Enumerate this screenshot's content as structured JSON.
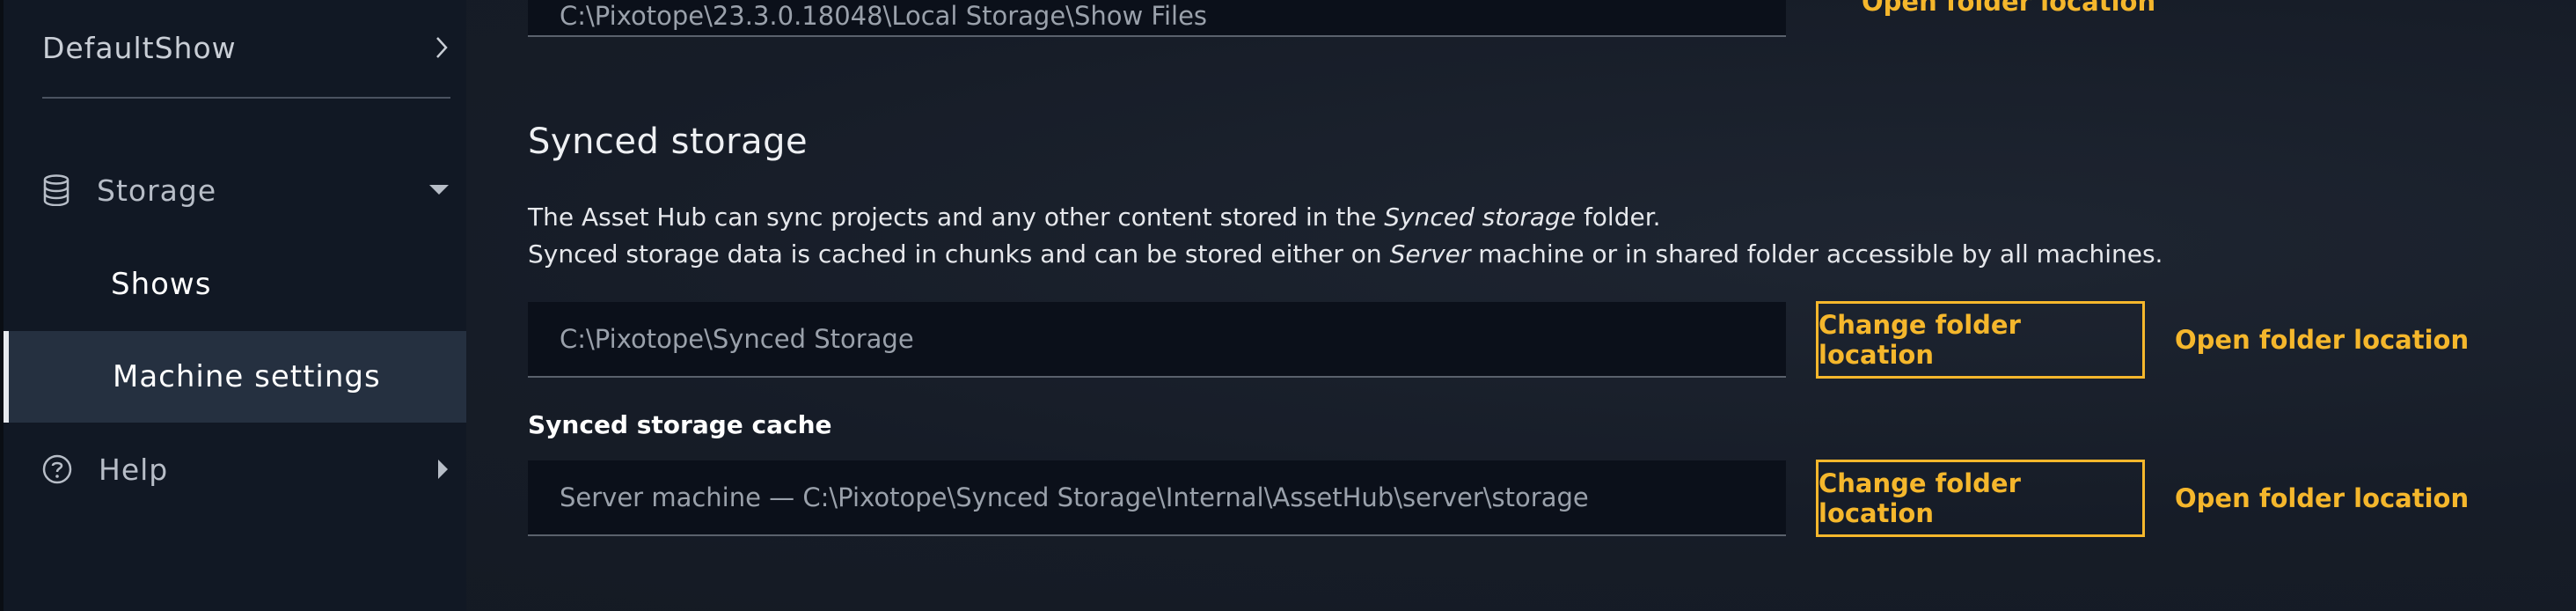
{
  "sidebar": {
    "show": {
      "label": "DefaultShow",
      "icon": "chevron-right-icon"
    },
    "storage": {
      "label": "Storage",
      "icon": "database-icon",
      "toggle_icon": "caret-down-icon"
    },
    "sub_items": [
      {
        "label": "Shows",
        "active": false
      },
      {
        "label": "Machine settings",
        "active": true
      }
    ],
    "help": {
      "label": "Help",
      "icon": "help-circle-icon",
      "toggle_icon": "caret-right-icon"
    }
  },
  "main": {
    "top_path": {
      "value": "C:\\Pixotope\\23.3.0.18048\\Local Storage\\Show Files",
      "open_label": "Open folder location"
    },
    "synced_storage": {
      "title": "Synced storage",
      "desc_line1_pre": "The Asset Hub can sync projects and any other content stored in the ",
      "desc_line1_em": "Synced storage",
      "desc_line1_post": " folder.",
      "desc_line2_pre": "Synced storage data is cached in chunks and can be stored either on ",
      "desc_line2_em": "Server",
      "desc_line2_post": " machine or in shared folder accessible by all machines.",
      "path": "C:\\Pixotope\\Synced Storage",
      "change_label": "Change folder location",
      "open_label": "Open folder location"
    },
    "synced_cache": {
      "label": "Synced storage cache",
      "path": "Server machine — C:\\Pixotope\\Synced Storage\\Internal\\AssetHub\\server\\storage",
      "change_label": "Change folder location",
      "open_label": "Open folder location"
    }
  },
  "colors": {
    "accent": "#f5b72c",
    "background": "#161c26",
    "sidebar": "#111824",
    "active_item": "#253040",
    "input_bg": "#0b101a"
  }
}
